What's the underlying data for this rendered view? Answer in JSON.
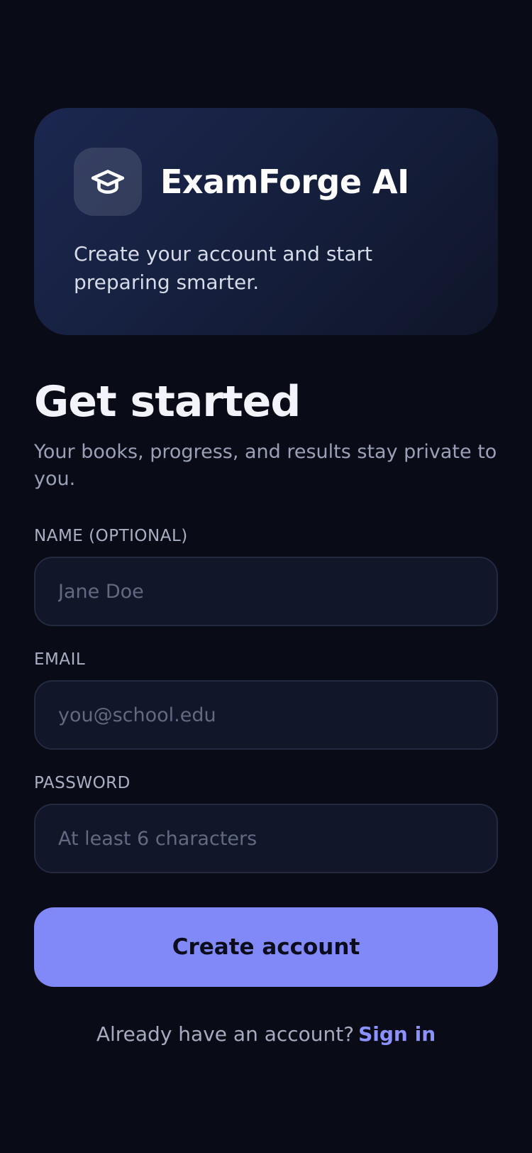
{
  "brand": {
    "name": "ExamForge AI",
    "tagline": "Create your account and start preparing smarter.",
    "icon": "graduation-cap-icon"
  },
  "form": {
    "heading": "Get started",
    "subheading": "Your books, progress, and results stay private to you.",
    "name_label": "NAME (OPTIONAL)",
    "name_placeholder": "Jane Doe",
    "name_value": "",
    "email_label": "EMAIL",
    "email_placeholder": "you@school.edu",
    "email_value": "",
    "password_label": "PASSWORD",
    "password_placeholder": "At least 6 characters",
    "password_value": "",
    "submit_label": "Create account"
  },
  "footer": {
    "prompt": "Already have an account?",
    "link_label": "Sign in"
  },
  "colors": {
    "background": "#090b16",
    "accent": "#8188f7",
    "link": "#8b91ff"
  }
}
